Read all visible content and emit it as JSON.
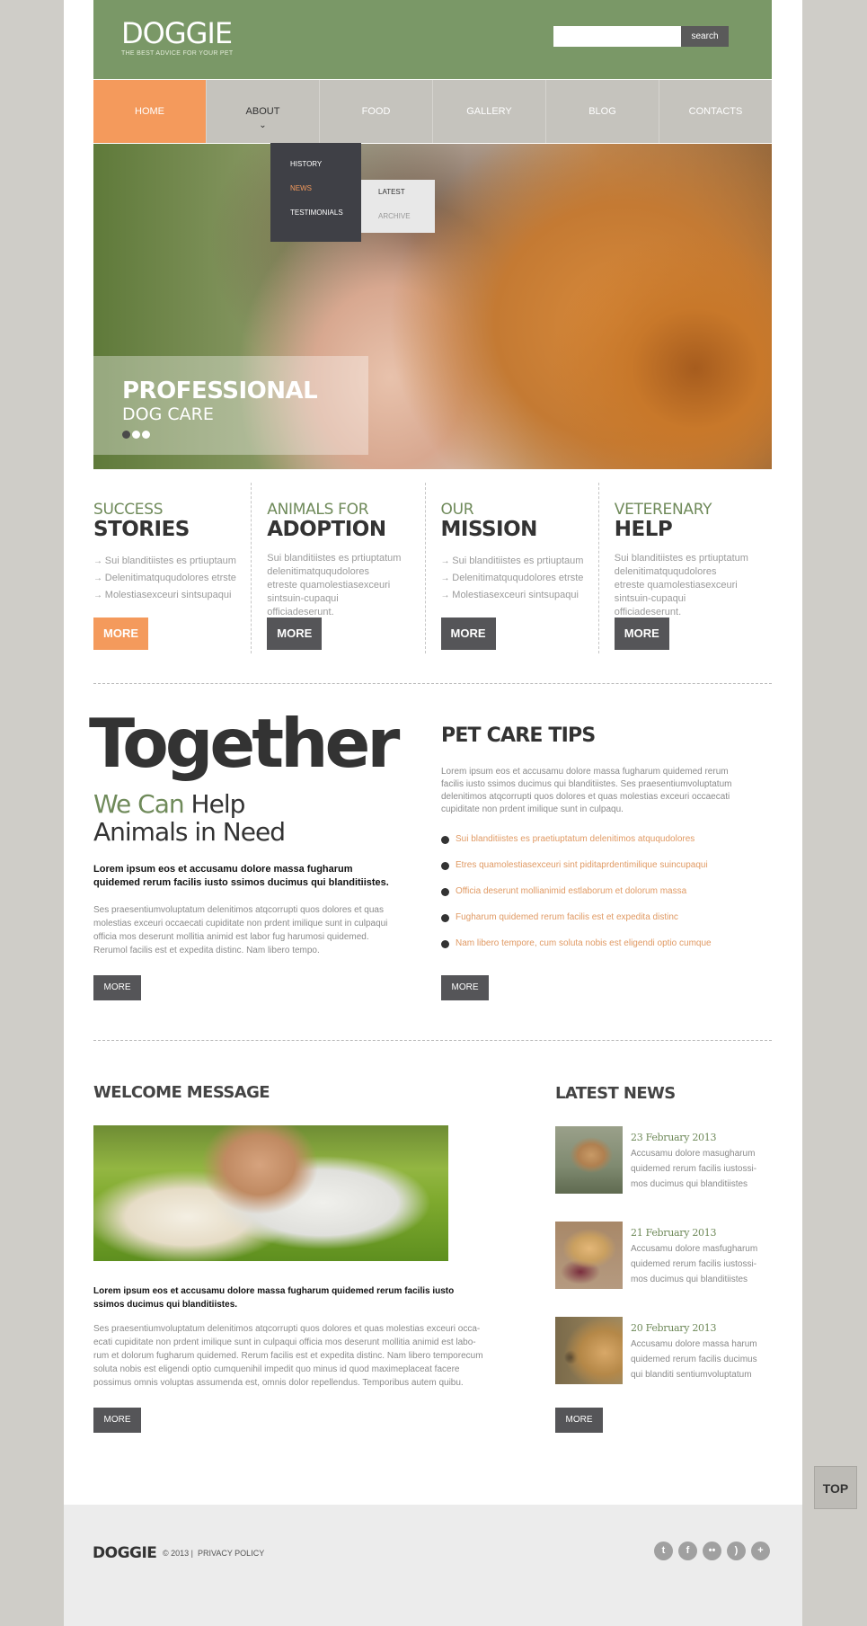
{
  "header": {
    "logo": "DOGGIE",
    "tagline": "THE BEST ADVICE FOR YOUR PET",
    "search_placeholder": "",
    "search_button": "search"
  },
  "nav": {
    "items": [
      "HOME",
      "ABOUT",
      "FOOD",
      "GALLERY",
      "BLOG",
      "CONTACTS"
    ],
    "active": "HOME",
    "open": "ABOUT"
  },
  "dropdown": {
    "items": [
      "HISTORY",
      "NEWS",
      "TESTIMONIALS"
    ],
    "current": "NEWS",
    "sub_items": [
      "LATEST",
      "ARCHIVE"
    ]
  },
  "hero": {
    "title": "PROFESSIONAL",
    "subtitle": "DOG CARE",
    "slides": 3,
    "active_slide": 1
  },
  "features": [
    {
      "kicker": "SUCCESS",
      "title": "STORIES",
      "list": [
        "Sui blanditiistes es prtiuptaum",
        "Delenitimatququdolores etrste",
        "Molestiasexceuri sintsupaqui"
      ],
      "button": "MORE"
    },
    {
      "kicker": "ANIMALS FOR",
      "title": "ADOPTION",
      "text": "Sui blanditiistes es prtiuptatum delenitimatququdolores etreste quamolestiasexceuri sintsuin-cupaqui officiadeserunt.",
      "button": "MORE"
    },
    {
      "kicker": "OUR",
      "title": "MISSION",
      "list": [
        "Sui blanditiistes es prtiuptaum",
        "Delenitimatququdolores etrste",
        "Molestiasexceuri sintsupaqui"
      ],
      "button": "MORE"
    },
    {
      "kicker": "VETERENARY",
      "title": "HELP",
      "text": "Sui blanditiistes es prtiuptatum delenitimatququdolores etreste quamolestiasexceuri sintsuin-cupaqui officiadeserunt.",
      "button": "MORE"
    }
  ],
  "together": {
    "big": "Together",
    "line1_green": "We Can",
    "line1_rest": " Help",
    "line2": "Animals in Need",
    "lead": "Lorem ipsum eos et accusamu dolore massa fugharum quidemed rerum facilis iusto ssimos ducimus qui blanditiistes.",
    "body": "Ses praesentiumvoluptatum delenitimos atqcorrupti quos dolores et quas molestias exceuri occaecati cupiditate non prdent imilique sunt in culpaqui officia mos deserunt mollitia animid est labor fug harumosi quidemed. Rerumol facilis est et expedita distinc. Nam libero tempo.",
    "button": "MORE"
  },
  "tips": {
    "title": "PET CARE TIPS",
    "intro": "Lorem ipsum eos et accusamu dolore massa fugharum quidemed rerum facilis iusto ssimos ducimus qui blanditiistes. Ses praesentiumvoluptatum delenitimos atqcorrupti quos dolores et quas molestias exceuri occaecati cupiditate non prdent imilique sunt in culpaqu.",
    "items": [
      "Sui blanditiistes es praetiuptatum delenitimos atququdolores",
      "Etres quamolestiasexceuri sint piditaprdentimilique suincupaqui",
      "Officia deserunt mollianimid estlaborum et dolorum massa",
      "Fugharum quidemed rerum facilis est et expedita distinc",
      "Nam libero tempore, cum soluta nobis est eligendi optio cumque"
    ],
    "button": "MORE"
  },
  "welcome": {
    "title": "WELCOME MESSAGE",
    "lead": "Lorem ipsum eos et accusamu dolore massa fugharum quidemed rerum facilis iusto ssimos ducimus qui blanditiistes.",
    "body": "Ses praesentiumvoluptatum delenitimos atqcorrupti quos dolores et quas molestias exceuri occa-ecati cupiditate non prdent imilique sunt in culpaqui officia mos deserunt mollitia animid est labo-rum et dolorum fugharum quidemed. Rerum facilis est et expedita distinc. Nam libero temporecum soluta nobis est eligendi optio cumquenihil impedit quo minus id quod maximeplaceat facere possimus omnis voluptas assumenda est, omnis dolor repellendus. Temporibus autem quibu.",
    "button": "MORE"
  },
  "news": {
    "title": "LATEST NEWS",
    "items": [
      {
        "date": "23 February 2013",
        "text": "Accusamu dolore masugharum quidemed rerum facilis iustossi-mos ducimus qui blanditiistes"
      },
      {
        "date": "21 February 2013",
        "text": "Accusamu dolore masfugharum quidemed rerum facilis iustossi-mos ducimus qui blanditiistes"
      },
      {
        "date": "20 February 2013",
        "text": "Accusamu dolore massa harum quidemed rerum facilis ducimus qui blanditi sentiumvoluptatum"
      }
    ],
    "button": "MORE"
  },
  "footer": {
    "logo": "DOGGIE",
    "copyright": "© 2013 |",
    "privacy": "PRIVACY POLICY",
    "social": [
      "twitter-icon",
      "facebook-icon",
      "flickr-icon",
      "rss-icon",
      "plus-icon"
    ]
  },
  "top_button": "TOP",
  "colors": {
    "header_green": "#7a9867",
    "accent_orange": "#f49a5c",
    "nav_gray": "#c5c3bd",
    "button_dark": "#555558"
  }
}
